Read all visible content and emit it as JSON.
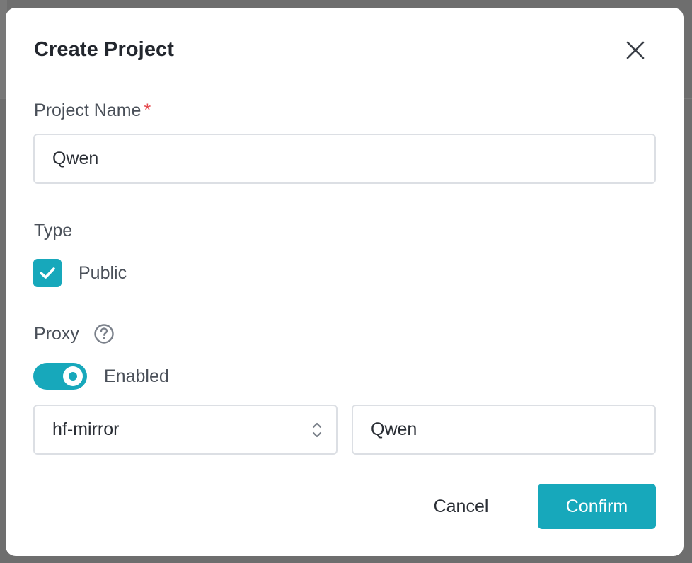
{
  "dialog": {
    "title": "Create Project",
    "close_icon": "close-icon"
  },
  "project_name": {
    "label": "Project Name",
    "required_mark": "*",
    "value": "Qwen"
  },
  "type": {
    "label": "Type",
    "public_label": "Public",
    "public_checked": true
  },
  "proxy": {
    "label": "Proxy",
    "help_icon": "question-circle-icon",
    "toggle_label": "Enabled",
    "toggle_on": true,
    "source_selected": "hf-mirror",
    "target_value": "Qwen"
  },
  "actions": {
    "cancel_label": "Cancel",
    "confirm_label": "Confirm"
  },
  "colors": {
    "accent": "#17a8bb",
    "required": "#e5484d"
  }
}
